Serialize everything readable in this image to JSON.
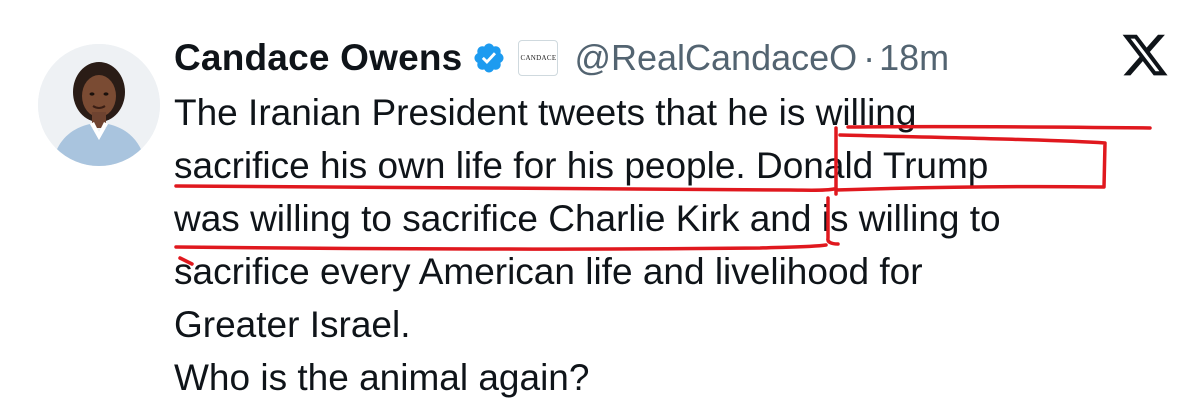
{
  "author": {
    "name": "Candace Owens",
    "handle": "@RealCandaceO",
    "separator": "·",
    "time": "18m",
    "affiliate_badge_text": "CANDACE",
    "verified_icon": "verified-badge-icon",
    "verified_color": "#1d9bf0"
  },
  "platform_logo": "x-logo-icon",
  "tweet": {
    "lines": [
      "The Iranian President tweets that he is willing",
      "sacrifice his own life for his people. Donald Trump",
      "was willing to sacrifice Charlie Kirk and is willing to",
      "sacrifice every American life and livelihood for",
      "Greater Israel.",
      "Who is the animal again?"
    ]
  },
  "colors": {
    "text": "#0f1419",
    "secondary_text": "#536471",
    "annotation_red": "#e0181e"
  }
}
